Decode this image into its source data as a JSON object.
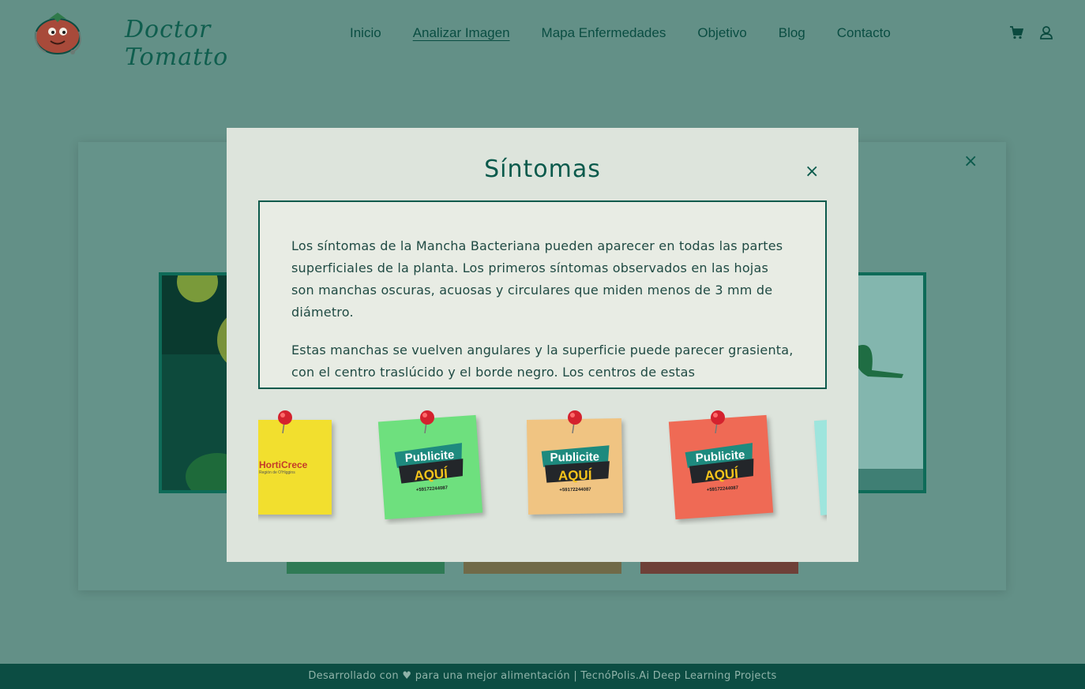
{
  "brand": {
    "name": "Doctor Tomatto",
    "logo_icon": "tomato-doctor-icon"
  },
  "nav": {
    "items": [
      {
        "label": "Inicio",
        "active": false
      },
      {
        "label": "Analizar Imagen",
        "active": true
      },
      {
        "label": "Mapa Enfermedades",
        "active": false
      },
      {
        "label": "Objetivo",
        "active": false
      },
      {
        "label": "Blog",
        "active": false
      },
      {
        "label": "Contacto",
        "active": false
      }
    ],
    "icons": [
      "cart-icon",
      "user-icon"
    ]
  },
  "background_card": {
    "close_icon": "close-icon"
  },
  "modal": {
    "title": "Síntomas",
    "close_symbol": "×",
    "paragraphs": [
      "Los síntomas de la Mancha Bacteriana pueden aparecer en todas las partes superficiales de la planta. Los primeros síntomas observados en las hojas son manchas oscuras, acuosas y circulares que miden menos de 3 mm de diámetro.",
      "Estas manchas se vuelven angulares y la superficie puede parecer grasienta, con el centro traslúcido y el borde negro. Los centros de estas"
    ]
  },
  "ads": [
    {
      "kind": "brand",
      "brand_text": "HortiCrece",
      "brand_sub": "Región de O'Higgins",
      "color": "#f2df2e"
    },
    {
      "kind": "publicite",
      "line1": "Publicite",
      "line2": "AQUÍ",
      "phone": "+59172244087",
      "color": "#6ee07e"
    },
    {
      "kind": "publicite",
      "line1": "Publicite",
      "line2": "AQUÍ",
      "phone": "+59172244087",
      "color": "#f0c482"
    },
    {
      "kind": "publicite",
      "line1": "Publicite",
      "line2": "AQUÍ",
      "phone": "+59172244087",
      "color": "#ef6a55"
    },
    {
      "kind": "blank",
      "color": "#9ee5dd"
    }
  ],
  "footer": {
    "text": "Desarrollado con ♥ para una mejor alimentación | TecnóPolis.Ai Deep Learning Projects"
  },
  "colors": {
    "primary": "#0b5a4c",
    "overlay": "#639087",
    "modal_bg": "#dde4dc",
    "footer_bg": "#0c4d43"
  }
}
